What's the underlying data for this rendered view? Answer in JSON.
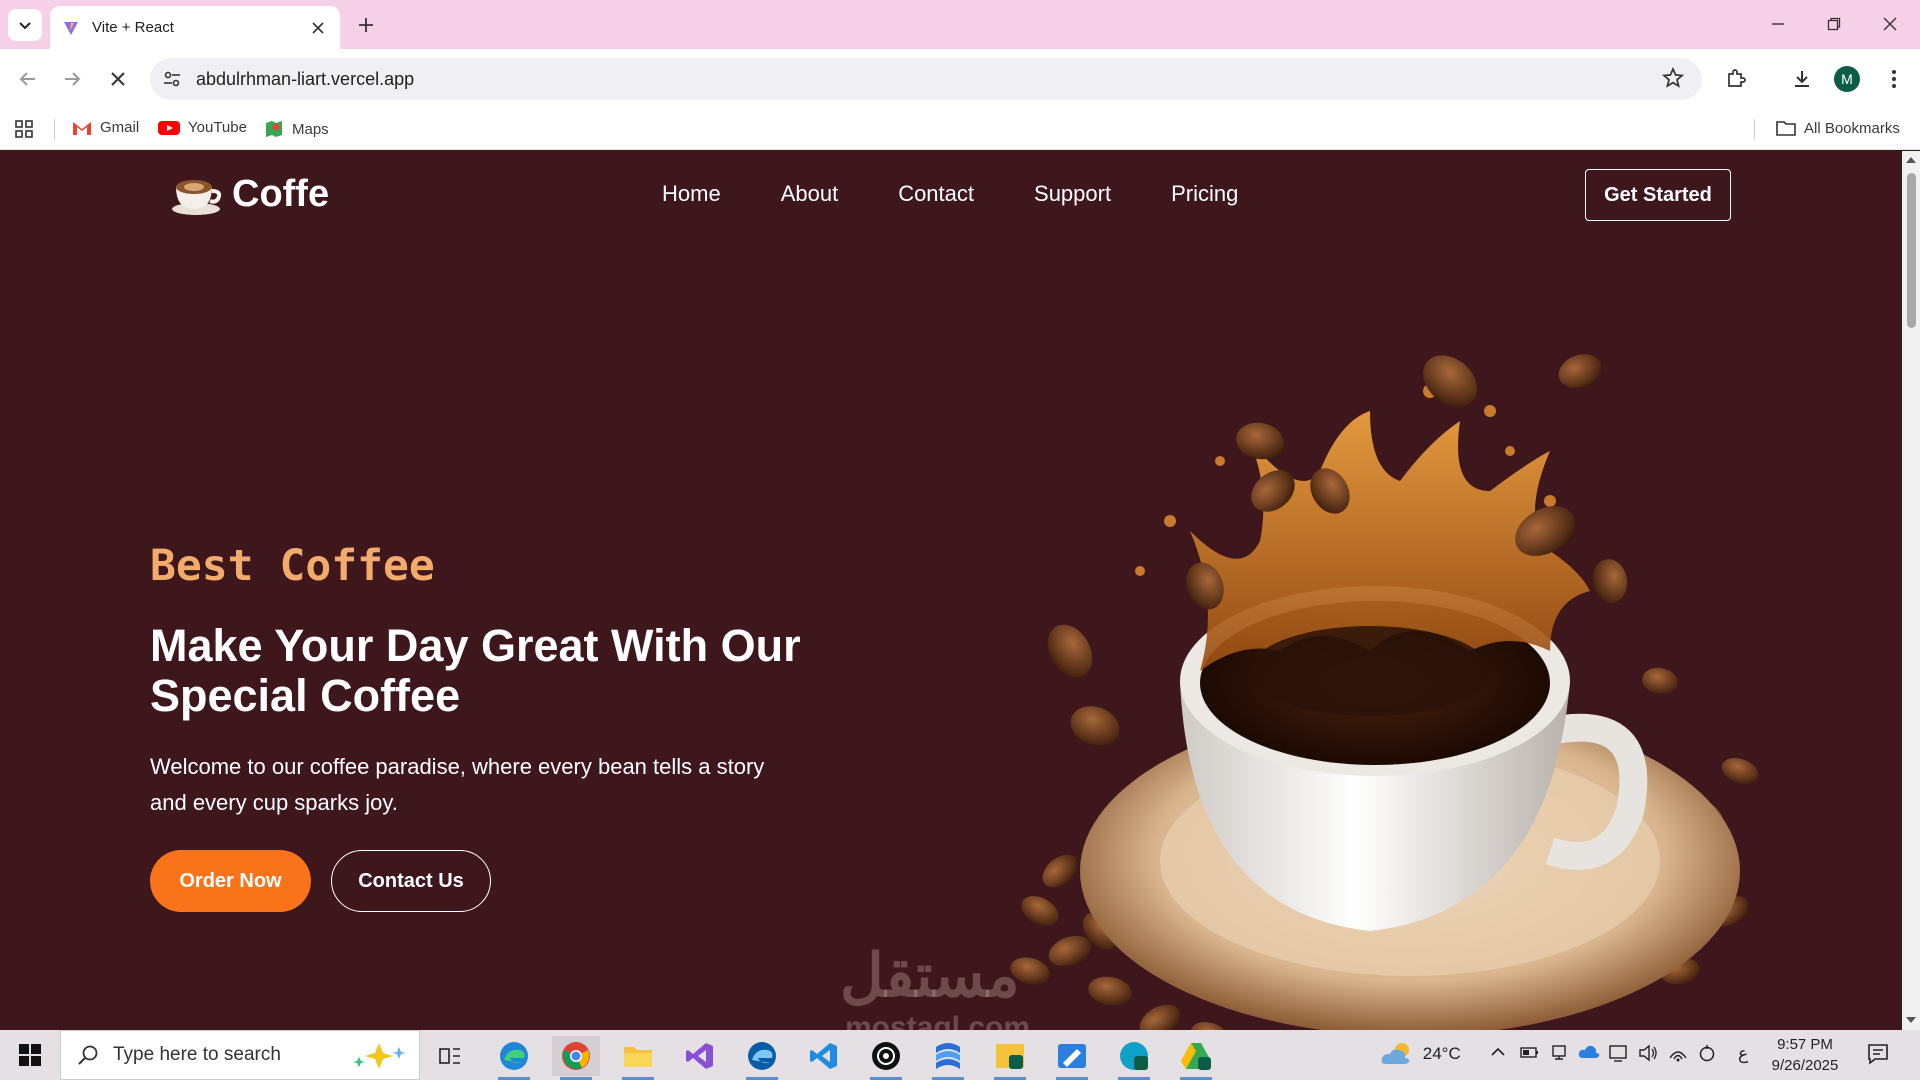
{
  "browser": {
    "tab_title": "Vite + React",
    "url": "abdulrhman-liart.vercel.app",
    "avatar_letter": "M",
    "bookmarks": [
      {
        "label": "Gmail"
      },
      {
        "label": "YouTube"
      },
      {
        "label": "Maps"
      }
    ],
    "all_bookmarks_label": "All Bookmarks"
  },
  "site": {
    "brand": "Coffe",
    "nav": [
      "Home",
      "About",
      "Contact",
      "Support",
      "Pricing"
    ],
    "cta_label": "Get Started",
    "hero": {
      "eyebrow": "Best Coffee",
      "title": "Make Your Day Great With Our Special Coffee",
      "description": "Welcome to our coffee paradise, where every bean tells a story and every cup sparks joy.",
      "primary_button": "Order Now",
      "secondary_button": "Contact Us"
    },
    "colors": {
      "background": "#3e171d",
      "accent": "#f9731a",
      "eyebrow": "#f3ab6c"
    }
  },
  "watermark": {
    "arabic": "مستقل",
    "latin": "mostaql.com"
  },
  "taskbar": {
    "search_placeholder": "Type here to search",
    "weather": "24°C",
    "time": "9:57 PM",
    "date": "9/26/2025",
    "lang": "ع"
  }
}
